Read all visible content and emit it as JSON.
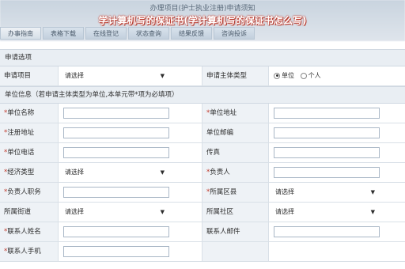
{
  "page_title": "办理项目(护士执业注册)申请须知",
  "overlay_title": "学计算机写的保证书(学计算机写的保证书怎么写)",
  "tabs": [
    "办事指南",
    "表格下载",
    "在线登记",
    "状态查询",
    "结果反馈",
    "咨询投诉"
  ],
  "section1": {
    "title": "申请选项",
    "row": {
      "label1": "申请项目",
      "select_value": "请选择",
      "label2": "申请主体类型",
      "radio_on": "单位",
      "radio_off": "个人"
    }
  },
  "section2": {
    "title": "单位信息（若申请主体类型为单位,本单元带*项为必填项）",
    "rows": [
      {
        "l1": "*单位名称",
        "v1": "input",
        "l2": "*单位地址",
        "v2": "input"
      },
      {
        "l1": "*注册地址",
        "v1": "input",
        "l2": "单位邮编",
        "v2": "input"
      },
      {
        "l1": "*单位电话",
        "v1": "input",
        "l2": "传真",
        "v2": "input"
      },
      {
        "l1": "*经济类型",
        "v1": "select",
        "l2": "*负责人",
        "v2": "input"
      },
      {
        "l1": "*负责人职务",
        "v1": "input",
        "l2": "*所属区县",
        "v2": "select"
      },
      {
        "l1": "所属街道",
        "v1": "select",
        "l2": "所属社区",
        "v2": "select"
      },
      {
        "l1": "*联系人姓名",
        "v1": "input",
        "l2": "联系人邮件",
        "v2": "input"
      },
      {
        "l1": "*联系人手机",
        "v1": "input",
        "l2": "",
        "v2": "none"
      }
    ],
    "select_placeholder": "请选择"
  }
}
